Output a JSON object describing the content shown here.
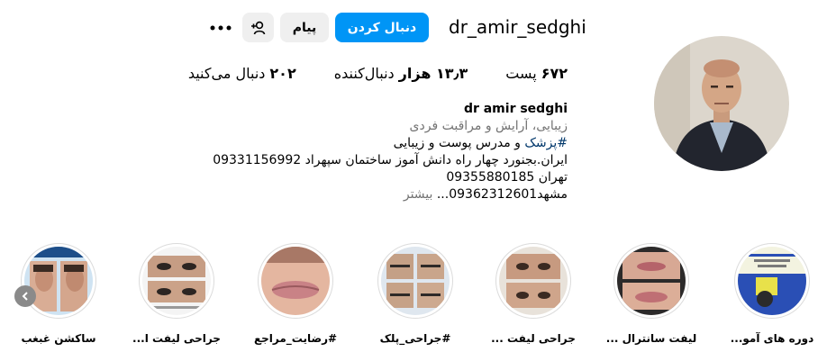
{
  "profile": {
    "username": "dr_amir_sedghi",
    "follow_label": "دنبال کردن",
    "message_label": "پیام",
    "more_icon": "more-dots-icon",
    "adduser_icon": "add-user-icon"
  },
  "stats": {
    "posts": {
      "value": "۶۷۲",
      "label": "پست"
    },
    "followers": {
      "value": "۱۳٫۳ هزار",
      "label": "دنبال‌کننده"
    },
    "following": {
      "value": "۲۰۲",
      "label": "دنبال می‌کنید"
    }
  },
  "bio": {
    "name": "dr amir sedghi",
    "category": "زیبایی، آرایش و مراقبت فردی",
    "line1_hashtag": "#پزشک",
    "line1_rest": " و مدرس پوست و زیبایی",
    "line2": "ایران.بجنورد چهار راه دانش آموز ساختمان سپهراد 09331156992",
    "line3": "تهران 09355880185",
    "line4": "مشهد09362312601...",
    "more": "بیشتر"
  },
  "highlights": [
    {
      "label": "دوره های آمو..."
    },
    {
      "label": "لیفت سانترال ..."
    },
    {
      "label": "جراحی لیفت ..."
    },
    {
      "label": "#جراحی_پلک"
    },
    {
      "label": "#رضایت_مراجع"
    },
    {
      "label": "جراحی لیفت ا..."
    },
    {
      "label": "ساکشن غبغب"
    }
  ],
  "colors": {
    "primary": "#0095f6",
    "secondary_bg": "#efefef",
    "muted": "#737373",
    "link": "#00376b"
  }
}
